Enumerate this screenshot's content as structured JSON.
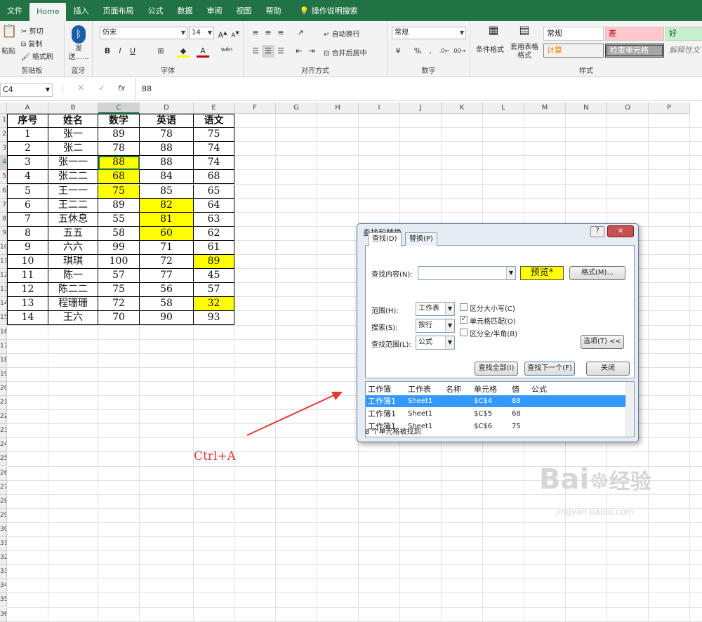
{
  "tabs": [
    "文件",
    "Home",
    "插入",
    "页面布局",
    "公式",
    "数据",
    "审阅",
    "视图",
    "帮助",
    "操作说明搜索"
  ],
  "ribbon": {
    "clipboard": {
      "paste": "粘贴",
      "cut": "剪切",
      "copy": "复制",
      "format_painter": "格式刷",
      "label": "剪贴板"
    },
    "bluetooth": {
      "send": "发送......",
      "label": "蓝牙"
    },
    "font": {
      "name": "仿宋",
      "size": "14",
      "label": "字体",
      "bold": "B",
      "italic": "I",
      "underline": "U",
      "font_color": "A",
      "wen": "wén"
    },
    "alignment": {
      "wrap": "自动换行",
      "merge": "合并后居中",
      "label": "对齐方式"
    },
    "number": {
      "format": "常规",
      "label": "数字",
      "percent": "%"
    },
    "styles": {
      "cond_format": "条件格式",
      "table_format": "套用表格格式",
      "normal": "常规",
      "bad": "差",
      "good": "好",
      "calc": "计算",
      "check": "检查单元格",
      "explain": "解释性文",
      "label": "样式"
    }
  },
  "formula_bar": {
    "name_box": "C4",
    "fx": "fx",
    "value": "88"
  },
  "columns": [
    "A",
    "B",
    "C",
    "D",
    "E",
    "F",
    "G",
    "H",
    "I",
    "J",
    "K",
    "L",
    "M",
    "N",
    "O",
    "P"
  ],
  "row_numbers": [
    "1",
    "2",
    "3",
    "4",
    "5",
    "6",
    "7",
    "8",
    "9",
    "10",
    "11",
    "12",
    "13",
    "14",
    "15",
    "16",
    "17",
    "18",
    "19",
    "20",
    "21",
    "22",
    "23",
    "24",
    "25",
    "26",
    "27",
    "28",
    "29",
    "30",
    "31",
    "32",
    "33",
    "34",
    "35",
    "36"
  ],
  "table": {
    "headers": [
      "序号",
      "姓名",
      "数学",
      "英语",
      "语文"
    ],
    "rows": [
      [
        "1",
        "张一",
        "89",
        "78",
        "75"
      ],
      [
        "2",
        "张二",
        "78",
        "88",
        "74"
      ],
      [
        "3",
        "张一一",
        "88",
        "88",
        "74"
      ],
      [
        "4",
        "张二二",
        "68",
        "84",
        "68"
      ],
      [
        "5",
        "王一一",
        "75",
        "85",
        "65"
      ],
      [
        "6",
        "王二二",
        "89",
        "82",
        "64"
      ],
      [
        "7",
        "五休息",
        "55",
        "81",
        "63"
      ],
      [
        "8",
        "五五",
        "58",
        "60",
        "62"
      ],
      [
        "9",
        "六六",
        "99",
        "71",
        "61"
      ],
      [
        "10",
        "琪琪",
        "100",
        "72",
        "89"
      ],
      [
        "11",
        "陈一",
        "57",
        "77",
        "45"
      ],
      [
        "12",
        "陈二二",
        "75",
        "56",
        "57"
      ],
      [
        "13",
        "程珊珊",
        "72",
        "58",
        "32"
      ],
      [
        "14",
        "王六",
        "70",
        "90",
        "93"
      ]
    ],
    "highlights": [
      [
        2,
        2
      ],
      [
        3,
        2
      ],
      [
        4,
        2
      ],
      [
        5,
        3
      ],
      [
        6,
        3
      ],
      [
        7,
        3
      ],
      [
        9,
        4
      ],
      [
        12,
        4
      ]
    ],
    "highlight_color": "#ffff00"
  },
  "annotation": {
    "text": "Ctrl+A",
    "color": "#e53935"
  },
  "dialog": {
    "title": "查找和替换",
    "help": "?",
    "close": "✕",
    "tab_find": "查找(D)",
    "tab_replace": "替换(P)",
    "find_label": "查找内容(N):",
    "preview": "预览*",
    "format_btn": "格式(M)...",
    "scope_label": "范围(H):",
    "scope": "工作表",
    "search_label": "搜索(S):",
    "search": "按行",
    "lookin_label": "查找范围(L):",
    "lookin": "公式",
    "match_case": "区分大小写(C)",
    "match_cell": "单元格匹配(O)",
    "match_width": "区分全/半角(B)",
    "options_btn": "选项(T) <<",
    "find_all": "查找全部(I)",
    "find_next": "查找下一个(F)",
    "close_btn": "关闭",
    "result_headers": [
      "工作簿",
      "工作表",
      "名称",
      "单元格",
      "值",
      "公式"
    ],
    "results": [
      [
        "工作簿1",
        "Sheet1",
        "",
        "$C$4",
        "88",
        ""
      ],
      [
        "工作簿1",
        "Sheet1",
        "",
        "$C$5",
        "68",
        ""
      ],
      [
        "工作簿1",
        "Sheet1",
        "",
        "$C$6",
        "75",
        ""
      ]
    ],
    "status": "8 个单元格被找到"
  },
  "watermark": {
    "brand": "Bai",
    "brand2": "经验",
    "url": "jingyan.baidu.com"
  }
}
